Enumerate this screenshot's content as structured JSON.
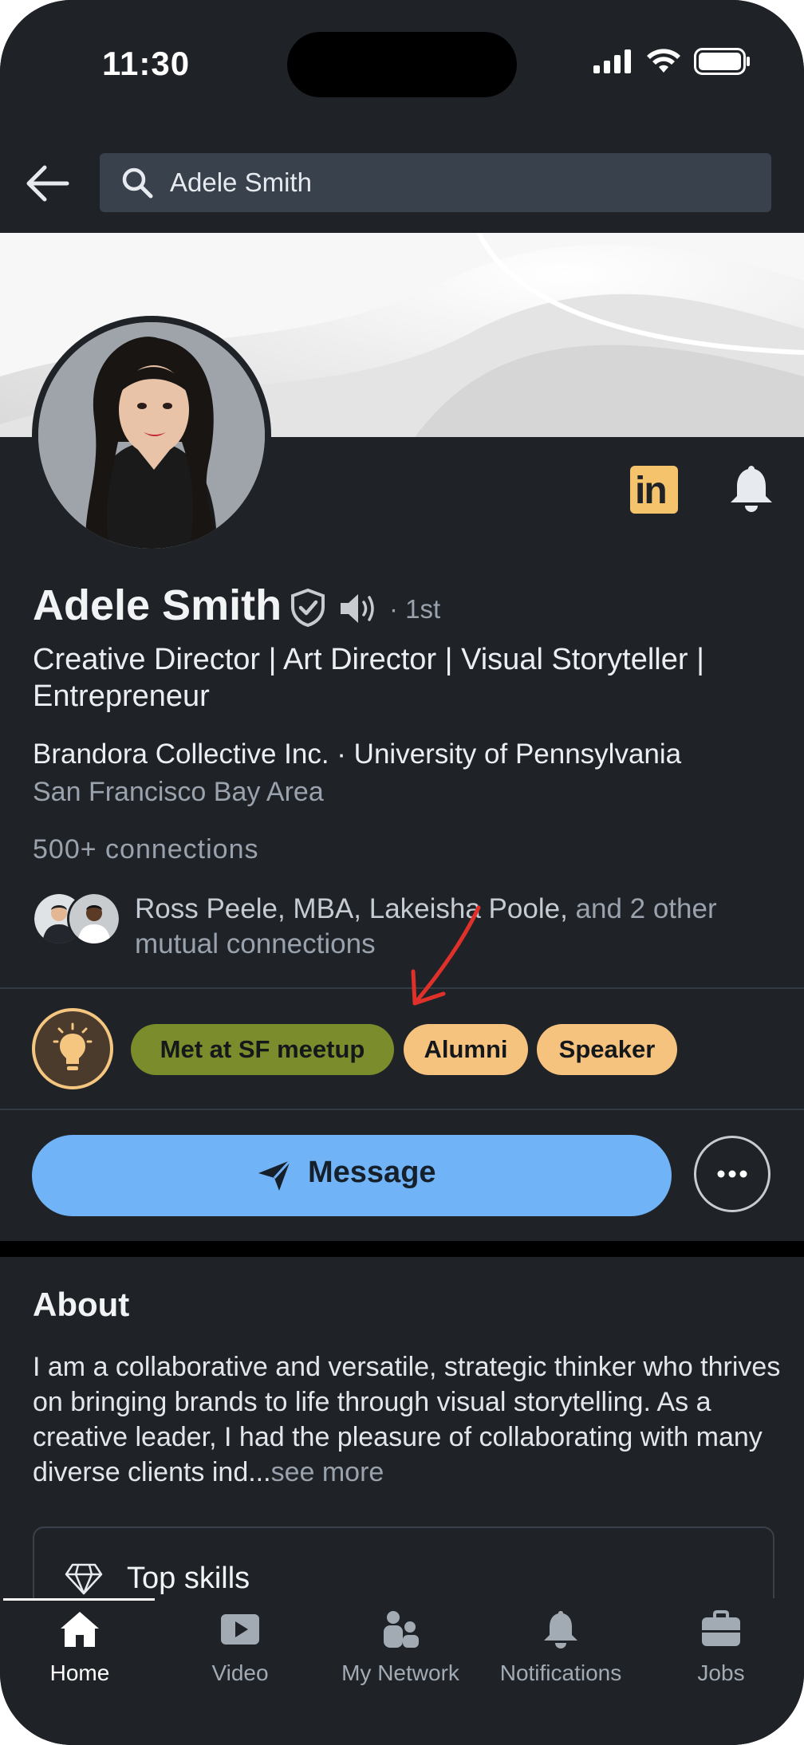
{
  "status_bar": {
    "time": "11:30"
  },
  "header": {
    "search_value": "Adele Smith"
  },
  "profile": {
    "name": "Adele Smith",
    "degree": "· 1st",
    "headline": "Creative Director | Art Director | Visual Storyteller | Entrepreneur",
    "company_school": "Brandora Collective Inc. · University of Pennsylvania",
    "location": "San Francisco Bay Area",
    "connections": "500+ connections",
    "mutual_names": "Ross Peele, MBA, Lakeisha Poole,",
    "mutual_rest": " and 2 other mutual connections"
  },
  "tags": [
    "Met at SF meetup",
    "Alumni",
    "Speaker"
  ],
  "actions": {
    "message_label": "Message"
  },
  "about": {
    "title": "About",
    "text": "I am a collaborative and versatile, strategic thinker who thrives on bringing brands to life through visual storytelling. As a creative leader, I had the pleasure of collaborating with many diverse clients ind...",
    "see_more": "see more"
  },
  "skills": {
    "title": "Top skills"
  },
  "tabbar": {
    "tabs": [
      {
        "label": "Home",
        "icon": "home-icon",
        "active": true
      },
      {
        "label": "Video",
        "icon": "video-icon",
        "active": false
      },
      {
        "label": "My Network",
        "icon": "network-icon",
        "active": false
      },
      {
        "label": "Notifications",
        "icon": "bell-icon",
        "active": false
      },
      {
        "label": "Jobs",
        "icon": "briefcase-icon",
        "active": false
      }
    ]
  },
  "colors": {
    "background": "#1f2328",
    "message_button": "#71b3f7",
    "tag_green": "#7a8c2c",
    "tag_peach": "#f6c37e",
    "annotation_arrow": "#e0302a"
  }
}
